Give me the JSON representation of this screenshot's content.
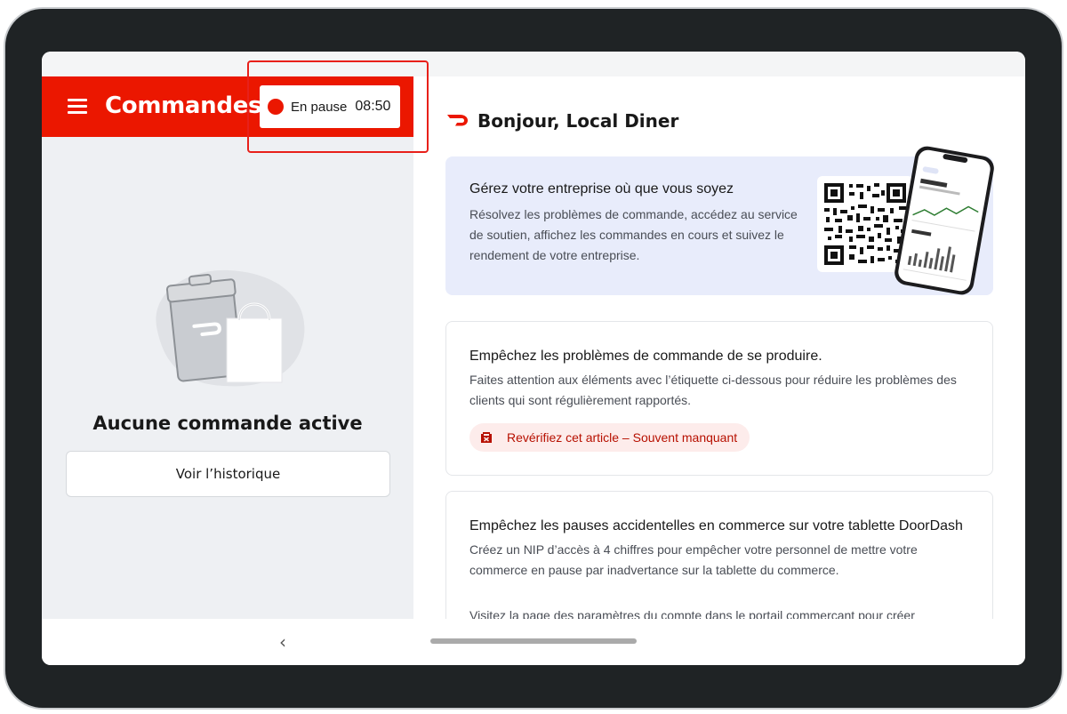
{
  "header": {
    "title": "Commandes",
    "pause_label": "En pause",
    "pause_timer": "08:50"
  },
  "left": {
    "empty_title": "Aucune commande active",
    "history_button": "Voir l’historique"
  },
  "right": {
    "greeting": "Bonjour, Local Diner",
    "promo": {
      "title": "Gérez votre entreprise où que vous soyez",
      "body": "Résolvez les problèmes de commande, accédez au service de soutien, affichez les commandes en cours et suivez le rendement de votre entreprise."
    },
    "card_issues": {
      "title": "Empêchez les problèmes de commande de se produire.",
      "body": "Faites attention aux éléments avec l’étiquette ci-dessous pour réduire les problèmes des clients qui sont régulièrement rapportés.",
      "tag": "Revérifiez cet article – Souvent manquant"
    },
    "card_pause": {
      "title": "Empêchez les pauses accidentelles en commerce sur votre tablette DoorDash",
      "body": "Créez un NIP d’accès à 4 chiffres pour empêcher votre personnel de mettre votre commerce en pause par inadvertance sur la tablette du commerce.",
      "body_extra": "Visitez la page des paramètres du compte dans le portail commerçant pour créer"
    }
  },
  "nav": {
    "back_glyph": "‹"
  },
  "colors": {
    "brand_red": "#eb1700",
    "promo_bg": "#e8ecfb",
    "tag_bg": "#fdeceb",
    "tag_text": "#b71000"
  },
  "icons": [
    "hamburger-icon",
    "status-dot-icon",
    "doordash-logo-icon",
    "qr-code",
    "phone-illustration",
    "alert-badge-icon",
    "chevron-left-icon"
  ]
}
